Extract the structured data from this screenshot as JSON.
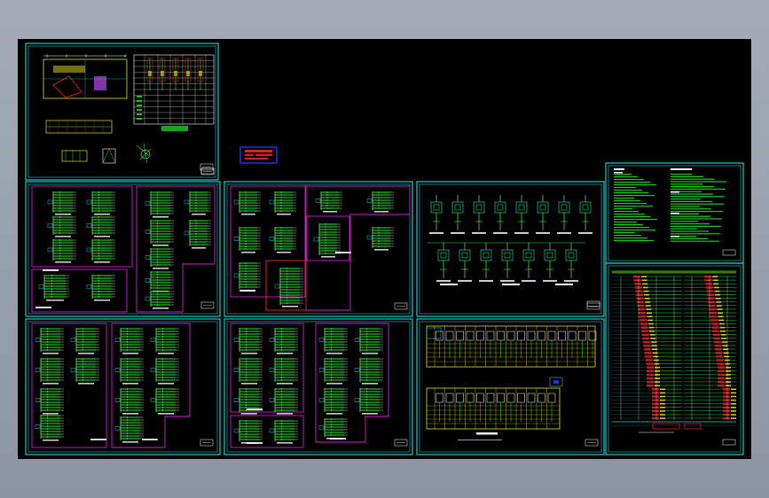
{
  "drawing": {
    "background": "#000000",
    "frame_color": "#1ec8c8",
    "region_color": "#d020d0",
    "circuit_color": "#22ee22",
    "label_color": "#ffffff",
    "table_color": "#e8e020",
    "accent_red": "#e02020",
    "accent_blue": "#2030ff"
  },
  "sheets": [
    {
      "id": "sheet-site-plan",
      "kind": "plan"
    },
    {
      "id": "sheet-legend",
      "kind": "legend-box"
    },
    {
      "id": "sheet-notes",
      "kind": "notes"
    },
    {
      "id": "sheet-panel-a",
      "kind": "panel-schedule"
    },
    {
      "id": "sheet-panel-b",
      "kind": "panel-schedule"
    },
    {
      "id": "sheet-meter-boxes",
      "kind": "meter-boxes"
    },
    {
      "id": "sheet-riser",
      "kind": "riser-diagram"
    },
    {
      "id": "sheet-panel-c",
      "kind": "panel-schedule"
    },
    {
      "id": "sheet-panel-d",
      "kind": "panel-schedule"
    },
    {
      "id": "sheet-switchgear",
      "kind": "switchgear-table"
    }
  ]
}
